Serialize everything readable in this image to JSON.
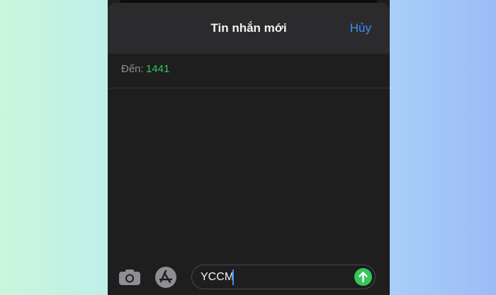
{
  "header": {
    "title": "Tin nhắn mới",
    "cancel_label": "Hủy"
  },
  "recipient": {
    "label": "Đến:",
    "value": "1441"
  },
  "compose": {
    "text": "YCCM",
    "camera_icon": "camera-icon",
    "appstore_icon": "app-store-icon",
    "send_icon": "arrow-up-icon"
  },
  "colors": {
    "accent_blue": "#3d8ff7",
    "accent_green": "#34c759",
    "background_dark": "#1e1e1e",
    "header_dark": "#2b2b2d"
  }
}
